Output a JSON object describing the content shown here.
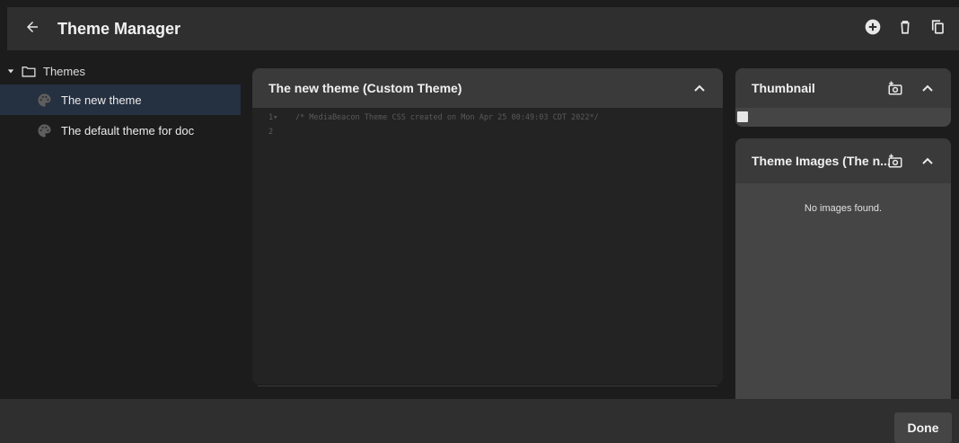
{
  "header": {
    "title": "Theme Manager",
    "back_icon": "arrow-left-icon",
    "actions": [
      "add-circle-icon",
      "trash-icon",
      "copy-icon"
    ]
  },
  "tree": {
    "root_label": "Themes",
    "items": [
      {
        "label": "The new theme",
        "selected": true
      },
      {
        "label": "The default theme for doc",
        "selected": false
      }
    ]
  },
  "editor": {
    "title": "The new theme (Custom Theme)",
    "lines": [
      {
        "number": "1▾",
        "text": "/* MediaBeacon Theme CSS created on Mon Apr 25 00:49:03 CDT 2022*/"
      },
      {
        "number": "2",
        "text": ""
      }
    ]
  },
  "thumbnail": {
    "title": "Thumbnail"
  },
  "theme_images": {
    "title": "Theme Images (The n...",
    "empty_text": "No images found."
  },
  "footer": {
    "done_label": "Done"
  },
  "colors": {
    "background": "#1c1c1c",
    "header": "#2f2f2f",
    "selected_row": "#253040",
    "panel": "#454545",
    "panel_header": "#3a3a3a"
  }
}
